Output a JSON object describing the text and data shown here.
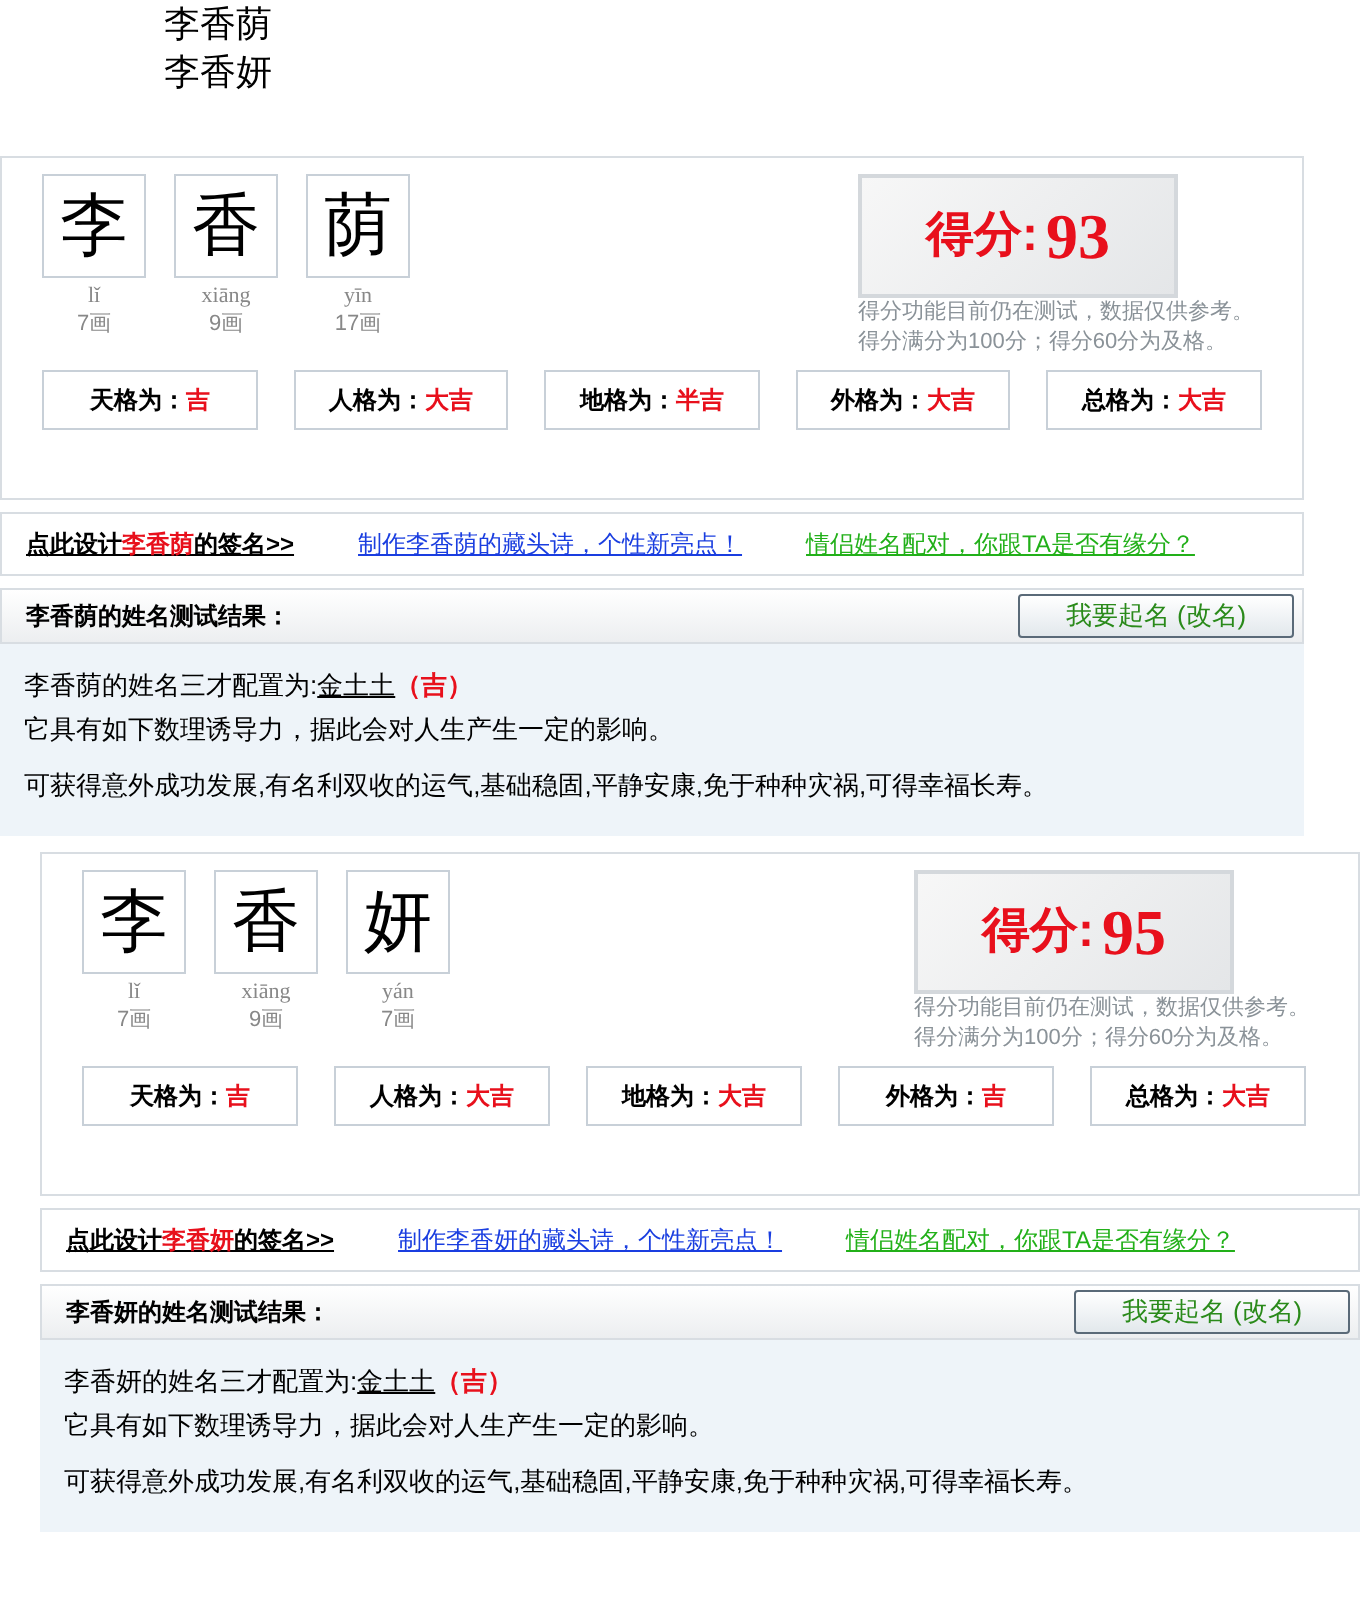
{
  "names": [
    "李香荫",
    "李香妍"
  ],
  "results": [
    {
      "chars": [
        {
          "char": "李",
          "pinyin": "lǐ",
          "strokes": "7画"
        },
        {
          "char": "香",
          "pinyin": "xiāng",
          "strokes": "9画"
        },
        {
          "char": "荫",
          "pinyin": "yīn",
          "strokes": "17画"
        }
      ],
      "score_label": "得分:",
      "score": "93",
      "score_notes": [
        "得分功能目前仍在测试，数据仅供参考。",
        "得分满分为100分；得分60分为及格。"
      ],
      "grids": [
        {
          "label": "天格为：",
          "value": "吉"
        },
        {
          "label": "人格为：",
          "value": "大吉"
        },
        {
          "label": "地格为：",
          "value": "半吉"
        },
        {
          "label": "外格为：",
          "value": "大吉"
        },
        {
          "label": "总格为：",
          "value": "大吉"
        }
      ],
      "sign_link": {
        "prefix": "点此设计",
        "name": "李香荫",
        "suffix": "的签名>>"
      },
      "poem_link": "制作李香荫的藏头诗，个性新亮点！",
      "match_link": "情侣姓名配对，你跟TA是否有缘分？",
      "result_title": "李香荫的姓名测试结果：",
      "rename_button": "我要起名 (改名)",
      "config_prefix": "李香荫的姓名三才配置为:",
      "config": "金土土",
      "verdict": "（吉）",
      "line2": "它具有如下数理诱导力，据此会对人生产生一定的影响。",
      "line3": "可获得意外成功发展,有名利双收的运气,基础稳固,平静安康,免于种种灾祸,可得幸福长寿。"
    },
    {
      "chars": [
        {
          "char": "李",
          "pinyin": "lǐ",
          "strokes": "7画"
        },
        {
          "char": "香",
          "pinyin": "xiāng",
          "strokes": "9画"
        },
        {
          "char": "妍",
          "pinyin": "yán",
          "strokes": "7画"
        }
      ],
      "score_label": "得分:",
      "score": "95",
      "score_notes": [
        "得分功能目前仍在测试，数据仅供参考。",
        "得分满分为100分；得分60分为及格。"
      ],
      "grids": [
        {
          "label": "天格为：",
          "value": "吉"
        },
        {
          "label": "人格为：",
          "value": "大吉"
        },
        {
          "label": "地格为：",
          "value": "大吉"
        },
        {
          "label": "外格为：",
          "value": "吉"
        },
        {
          "label": "总格为：",
          "value": "大吉"
        }
      ],
      "sign_link": {
        "prefix": "点此设计",
        "name": "李香妍",
        "suffix": "的签名>>"
      },
      "poem_link": "制作李香妍的藏头诗，个性新亮点！",
      "match_link": "情侣姓名配对，你跟TA是否有缘分？",
      "result_title": "李香妍的姓名测试结果：",
      "rename_button": "我要起名 (改名)",
      "config_prefix": "李香妍的姓名三才配置为:",
      "config": "金土土",
      "verdict": "（吉）",
      "line2": "它具有如下数理诱导力，据此会对人生产生一定的影响。",
      "line3": "可获得意外成功发展,有名利双收的运气,基础稳固,平静安康,免于种种灾祸,可得幸福长寿。"
    }
  ]
}
